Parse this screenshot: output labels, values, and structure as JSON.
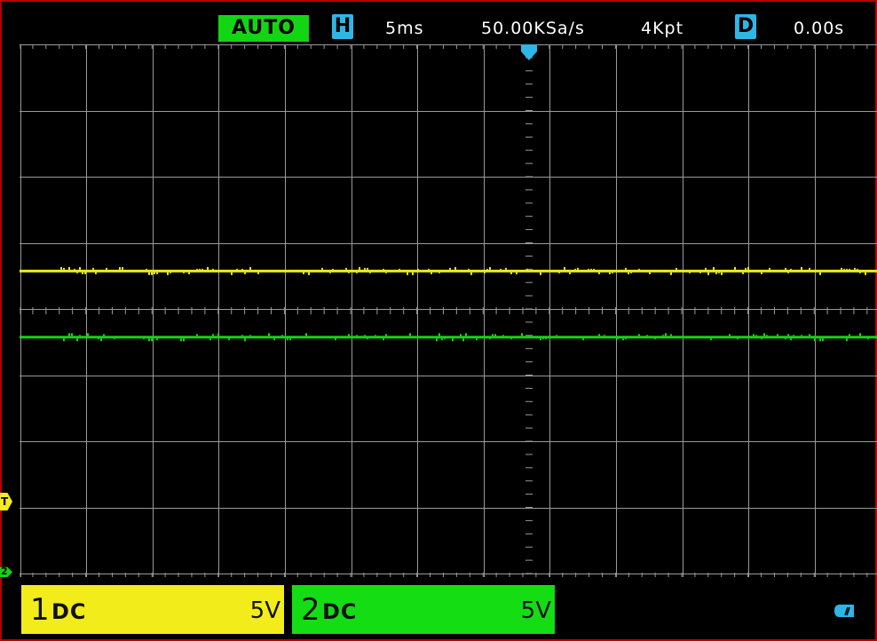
{
  "topbar": {
    "mode": "AUTO",
    "horizontal_badge": "H",
    "timebase": "5ms",
    "sample_rate": "50.00KSa/s",
    "memory_depth": "4Kpt",
    "delay_badge": "D",
    "delay": "0.00s"
  },
  "markers": {
    "trigger_label": "T",
    "ch2_label": "2"
  },
  "channels": [
    {
      "number": "1",
      "coupling": "DC",
      "scale": "5V",
      "color": "#f2ec1a"
    },
    {
      "number": "2",
      "coupling": "DC",
      "scale": "5V",
      "color": "#14dd14"
    }
  ],
  "colors": {
    "grid": "#9a9a9a",
    "ch1_trace": "#f4ec1c",
    "ch2_trace": "#13d613",
    "accent": "#2fb6e6",
    "frame": "#b80000"
  },
  "waveforms": {
    "ch1_level_div": 0.6,
    "ch2_level_div": -0.4
  },
  "status_icons": [
    "battery-icon"
  ]
}
